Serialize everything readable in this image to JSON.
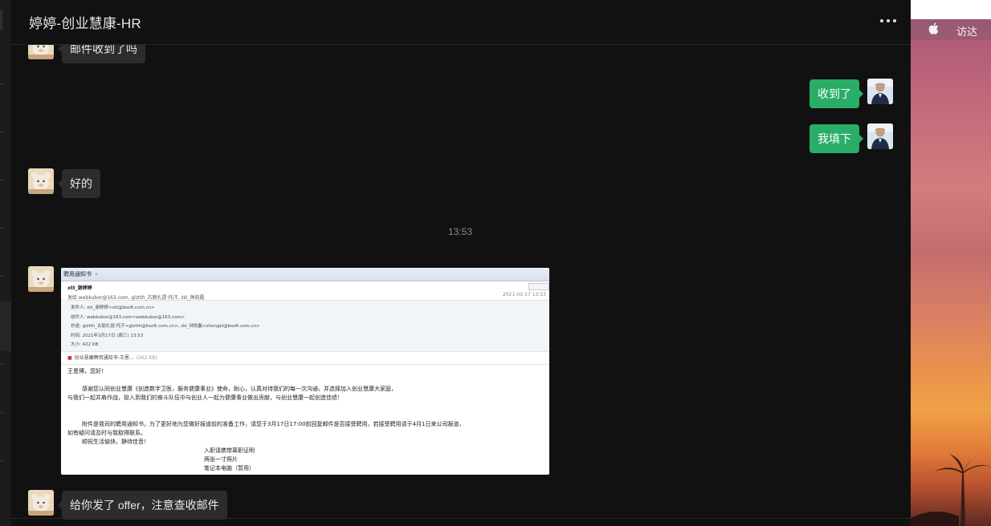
{
  "window": {
    "title": "婷婷-创业慧康-HR"
  },
  "messages": [
    {
      "side": "in",
      "text": "邮件收到了吗"
    },
    {
      "side": "out",
      "text": "收到了"
    },
    {
      "side": "out",
      "text": "我填下"
    },
    {
      "side": "in",
      "text": "好的"
    },
    {
      "side": "in",
      "text": "给你发了 offer，注意查收邮件"
    }
  ],
  "timestamp": "13:53",
  "email_image": {
    "window_title": "聘用通知书",
    "from_name": "xtt_谢婷婷",
    "recipients_line": "发给 webkubor@163.com, glztth_古丽扎提·托汗, zkl_钟凯磊",
    "date": "2021-03-17 13:53",
    "meta": {
      "sender": "发件人: xtt_谢婷婷<xtt@bsoft.com.cn>",
      "recipient": "收件人: webkubor@163.com<webkubor@163.com>",
      "cc": "抄送: glztth_古丽扎提·托汗<glztth@bsoft.com.cn>, zkl_钟凯磊<zhongkl@bsoft.com.cn>",
      "time": "时间: 2021年3月17日 (周三) 13:53",
      "size": "大小: 422 KB"
    },
    "attachment": {
      "name": "创业慧康聘用通知书-王恩...",
      "size": "(262 KB)"
    },
    "body": {
      "greeting": "王恩博，您好！",
      "p1a": "感谢您认同创业慧康《创造数字卫医，服务健康事业》使命，耐心，认真对待我们的每一次沟通，并选择加入创业慧康大家庭，",
      "p1b": "与我们一起并肩作战，投入到我们的奋斗队伍中与创业人一起为健康事业做出贡献，与创业慧康一起创造佳绩！",
      "p2a": "附件是我司的聘用通知书，为了更好地为您做好报道前的准备工作，请您于3月17日17:00前回复邮件是否接受聘用，若接受聘用请于4月1日来公司报道，",
      "p2b": "如有疑问请及时与我取得联系。",
      "p2c": "顺祝生活愉快，静待佳音！",
      "item1": "入职请携带离职证明",
      "item2": "两张一寸照片",
      "item3": "笔记本电脑（暂用）"
    }
  },
  "desktop": {
    "menu_item": "访达"
  },
  "colors": {
    "background": "#111111",
    "incoming_bubble": "#2c2c2c",
    "outgoing_bubble": "#2aae67",
    "timestamp": "#8a8a8a"
  }
}
